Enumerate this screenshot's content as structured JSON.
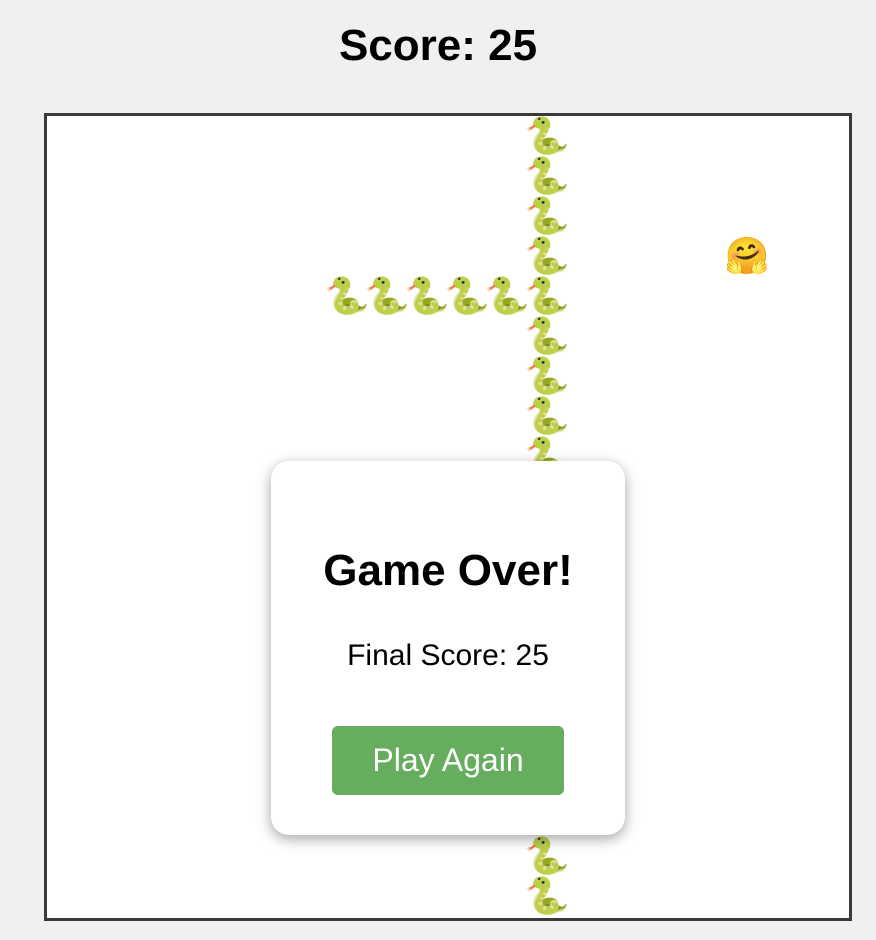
{
  "header": {
    "score_text": "Score: 25"
  },
  "board": {
    "snake_glyph": "🐍",
    "food_glyph": "🤗",
    "grid_size": 20,
    "snake_cells": [
      [
        12,
        0
      ],
      [
        12,
        1
      ],
      [
        12,
        2
      ],
      [
        12,
        3
      ],
      [
        12,
        4
      ],
      [
        12,
        5
      ],
      [
        12,
        6
      ],
      [
        12,
        7
      ],
      [
        12,
        8
      ],
      [
        12,
        9
      ],
      [
        12,
        10
      ],
      [
        12,
        11
      ],
      [
        12,
        12
      ],
      [
        12,
        13
      ],
      [
        12,
        14
      ],
      [
        12,
        15
      ],
      [
        12,
        16
      ],
      [
        12,
        17
      ],
      [
        12,
        18
      ],
      [
        12,
        19
      ],
      [
        7,
        4
      ],
      [
        8,
        4
      ],
      [
        9,
        4
      ],
      [
        10,
        4
      ],
      [
        11,
        4
      ]
    ],
    "food_cell": [
      17,
      3
    ]
  },
  "game_over": {
    "title": "Game Over!",
    "final_score_text": "Final Score: 25",
    "play_again_label": "Play Again"
  }
}
